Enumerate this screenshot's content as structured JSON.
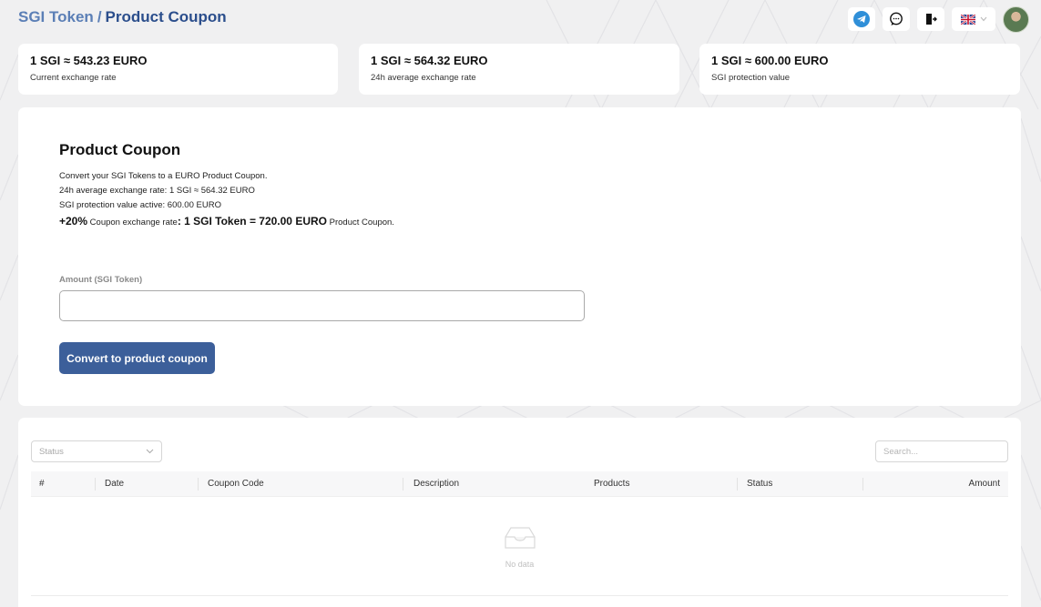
{
  "breadcrumb": {
    "root": "SGI Token",
    "separator": "/",
    "current": "Product Coupon"
  },
  "header": {
    "icons": [
      "telegram-icon",
      "chat-icon",
      "logout-icon",
      "uk-flag-icon",
      "chevron-down-icon"
    ]
  },
  "rates": [
    {
      "value": "1 SGI ≈ 543.23 EURO",
      "label": "Current exchange rate"
    },
    {
      "value": "1 SGI ≈ 564.32 EURO",
      "label": "24h average exchange rate"
    },
    {
      "value": "1 SGI ≈ 600.00 EURO",
      "label": "SGI protection value"
    }
  ],
  "coupon": {
    "title": "Product Coupon",
    "line1": "Convert your SGI Tokens to a EURO Product Coupon.",
    "line2": "24h average exchange rate: 1 SGI ≈ 564.32 EURO",
    "line3": "SGI protection value active: 600.00 EURO",
    "line4_bonus": "+20%",
    "line4_text": " Coupon exchange rate",
    "line4_rate": ": 1 SGI Token = 720.00 EURO",
    "line4_suffix": " Product Coupon.",
    "amount_label": "Amount (SGI Token)",
    "amount_value": "",
    "button_label": "Convert to product coupon"
  },
  "table": {
    "status_placeholder": "Status",
    "search_placeholder": "Search...",
    "columns": [
      "#",
      "Date",
      "Coupon Code",
      "Description",
      "Products",
      "Status",
      "Amount"
    ],
    "empty_text": "No data"
  },
  "colors": {
    "accent": "#3c5f9a",
    "breadcrumb_root": "#5b7fb6",
    "breadcrumb_current": "#2b4e8c",
    "telegram": "#2f8fd8"
  }
}
